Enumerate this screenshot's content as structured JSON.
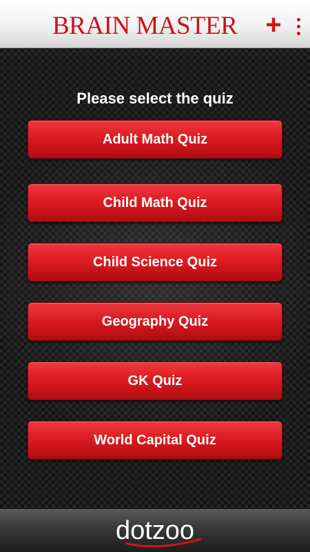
{
  "header": {
    "title": "BRAIN MASTER",
    "plus_label": "+",
    "overflow_icon": "overflow-menu-icon"
  },
  "main": {
    "prompt": "Please select the quiz",
    "quizzes": [
      "Adult Math Quiz",
      "Child Math Quiz",
      "Child Science Quiz",
      "Geography Quiz",
      "GK Quiz",
      "World Capital Quiz"
    ]
  },
  "footer": {
    "brand": "dotzoo"
  },
  "colors": {
    "accent": "#d4121a",
    "button": "#dc1c22",
    "background": "#1b1b1b"
  }
}
